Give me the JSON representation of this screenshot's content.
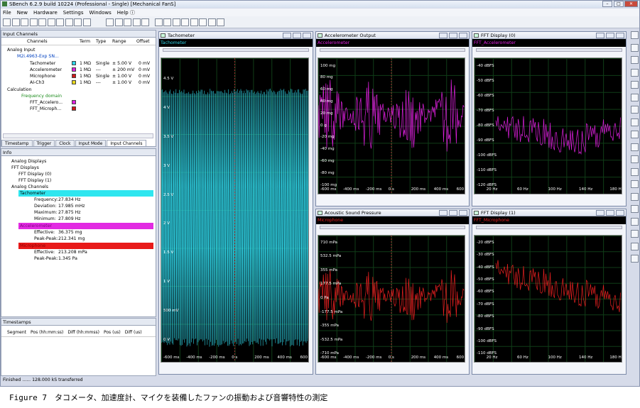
{
  "window": {
    "title": "SBench 6.2.9 build 10224 (Professional - Single)    [Mechanical FanS]"
  },
  "menu": [
    "File",
    "New",
    "Hardware",
    "Settings",
    "Windows",
    "Help ⓘ"
  ],
  "input_channels": {
    "title": "Input Channels",
    "columns": [
      "Channels",
      "Term",
      "Type",
      "Range",
      "Offset"
    ],
    "analog_input": "Analog Input",
    "device": "M2i.4963-Exp SN...",
    "channels": [
      {
        "name": "Tachometer",
        "term": "1 MΩ",
        "type": "Single",
        "range": "± 5.00 V",
        "offset": "0 mV",
        "color": "#2fd3e6"
      },
      {
        "name": "Accelerometer",
        "term": "1 MΩ",
        "type": "---",
        "range": "± 200 mV",
        "offset": "0 mV",
        "color": "#e020e0"
      },
      {
        "name": "Microphone",
        "term": "1 MΩ",
        "type": "Single",
        "range": "± 1.00 V",
        "offset": "0 mV",
        "color": "#d01818"
      },
      {
        "name": "AI-Ch3",
        "term": "1 MΩ",
        "type": "---",
        "range": "± 1.00 V",
        "offset": "0 mV",
        "color": "#e8d81c"
      }
    ],
    "calculation": "Calculation",
    "frequency_domain": "Frequency domain",
    "fft_items": [
      {
        "name": "FFT_Accelero...",
        "color": "#e020e0"
      },
      {
        "name": "FFT_Microph...",
        "color": "#d01818"
      }
    ],
    "tabs": [
      "Timestamp",
      "Trigger",
      "Clock",
      "Input Mode",
      "Input Channels"
    ]
  },
  "info": {
    "title": "Info",
    "analog_displays": "Analog Displays",
    "fft_displays": "FFT Displays",
    "fft0": "FFT Display (0)",
    "fft1": "FFT Display (1)",
    "analog_channels": "Analog Channels",
    "tach": {
      "name": "Tachometer",
      "frequency_label": "Frequency:",
      "frequency": "27.834 Hz",
      "deviation_label": "Deviation:",
      "deviation": "17.985 mHz",
      "maximum_label": "Maximum:",
      "maximum": "27.875 Hz",
      "minimum_label": "Minimum:",
      "minimum": "27.809 Hz"
    },
    "acc": {
      "name": "Accelerometer",
      "effective_label": "Effective:",
      "effective": "36.375 mg",
      "peak_label": "Peak-Peak:",
      "peak": "212.341 mg"
    },
    "mic": {
      "name": "Microphone",
      "effective_label": "Effective:",
      "effective": "213.208 mPa",
      "peak_label": "Peak-Peak:",
      "peak": "1.345 Pa"
    }
  },
  "timestamps": {
    "title": "Timestamps",
    "columns": [
      "Segment",
      "Pos (hh:mm:ss)",
      "Diff (hh:mmss)",
      "Pos (us)",
      "Diff (us)"
    ]
  },
  "status": "Finished ...... 128.000 kS transferred",
  "caption": "Figure 7　タコメータ、加速度計、マイクを装備したファンの振動および音響特性の測定",
  "displays": {
    "tach": {
      "title": "Tachometer",
      "channel": "Tachometer",
      "color": "#2fd3e6",
      "y": [
        "4.5 V",
        "4 V",
        "3.5 V",
        "3 V",
        "2.5 V",
        "2 V",
        "1.5 V",
        "1 V",
        "500 mV",
        "0 V"
      ],
      "x": [
        "-600 ms",
        "-400 ms",
        "-200 ms",
        "0 s",
        "200 ms",
        "400 ms",
        "600 m"
      ]
    },
    "acc": {
      "title": "Accelerometer Output",
      "channel": "Accelerometer",
      "color": "#e020e0",
      "y": [
        "100 mg",
        "80 mg",
        "60 mg",
        "40 mg",
        "20 mg",
        "0 g",
        "-20 mg",
        "-40 mg",
        "-60 mg",
        "-80 mg",
        "-100 mg"
      ],
      "x": [
        "-600 ms",
        "-400 ms",
        "-200 ms",
        "0 s",
        "200 ms",
        "400 ms",
        "600 m"
      ]
    },
    "mic": {
      "title": "Acoustic Sound Pressure",
      "channel": "Microphone",
      "color": "#e82020",
      "y": [
        "710 mPa",
        "532.5 mPa",
        "355 mPa",
        "177.5 mPa",
        "0 Pa",
        "-177.5 mPa",
        "-355 mPa",
        "-532.5 mPa",
        "-710 mPa"
      ],
      "x": [
        "-600 ms",
        "-400 ms",
        "-200 ms",
        "0 s",
        "200 ms",
        "400 ms",
        "600 m"
      ]
    },
    "fft0": {
      "title": "FFT Display (0)",
      "channel": "FFT_Accelerometer",
      "color": "#e020e0",
      "y": [
        "-40 dBFS",
        "-50 dBFS",
        "-60 dBFS",
        "-70 dBFS",
        "-80 dBFS",
        "-90 dBFS",
        "-100 dBFS",
        "-110 dBFS",
        "-120 dBFS"
      ],
      "x": [
        "20 Hz",
        "60 Hz",
        "100 Hz",
        "140 Hz",
        "180 Hz"
      ]
    },
    "fft1": {
      "title": "FFT Display (1)",
      "channel": "FFT_Microphone",
      "color": "#e82020",
      "y": [
        "-20 dBFS",
        "-30 dBFS",
        "-40 dBFS",
        "-50 dBFS",
        "-60 dBFS",
        "-70 dBFS",
        "-80 dBFS",
        "-90 dBFS",
        "-100 dBFS",
        "-110 dBFS"
      ],
      "x": [
        "20 Hz",
        "60 Hz",
        "100 Hz",
        "140 Hz",
        "180 Hz"
      ]
    }
  }
}
